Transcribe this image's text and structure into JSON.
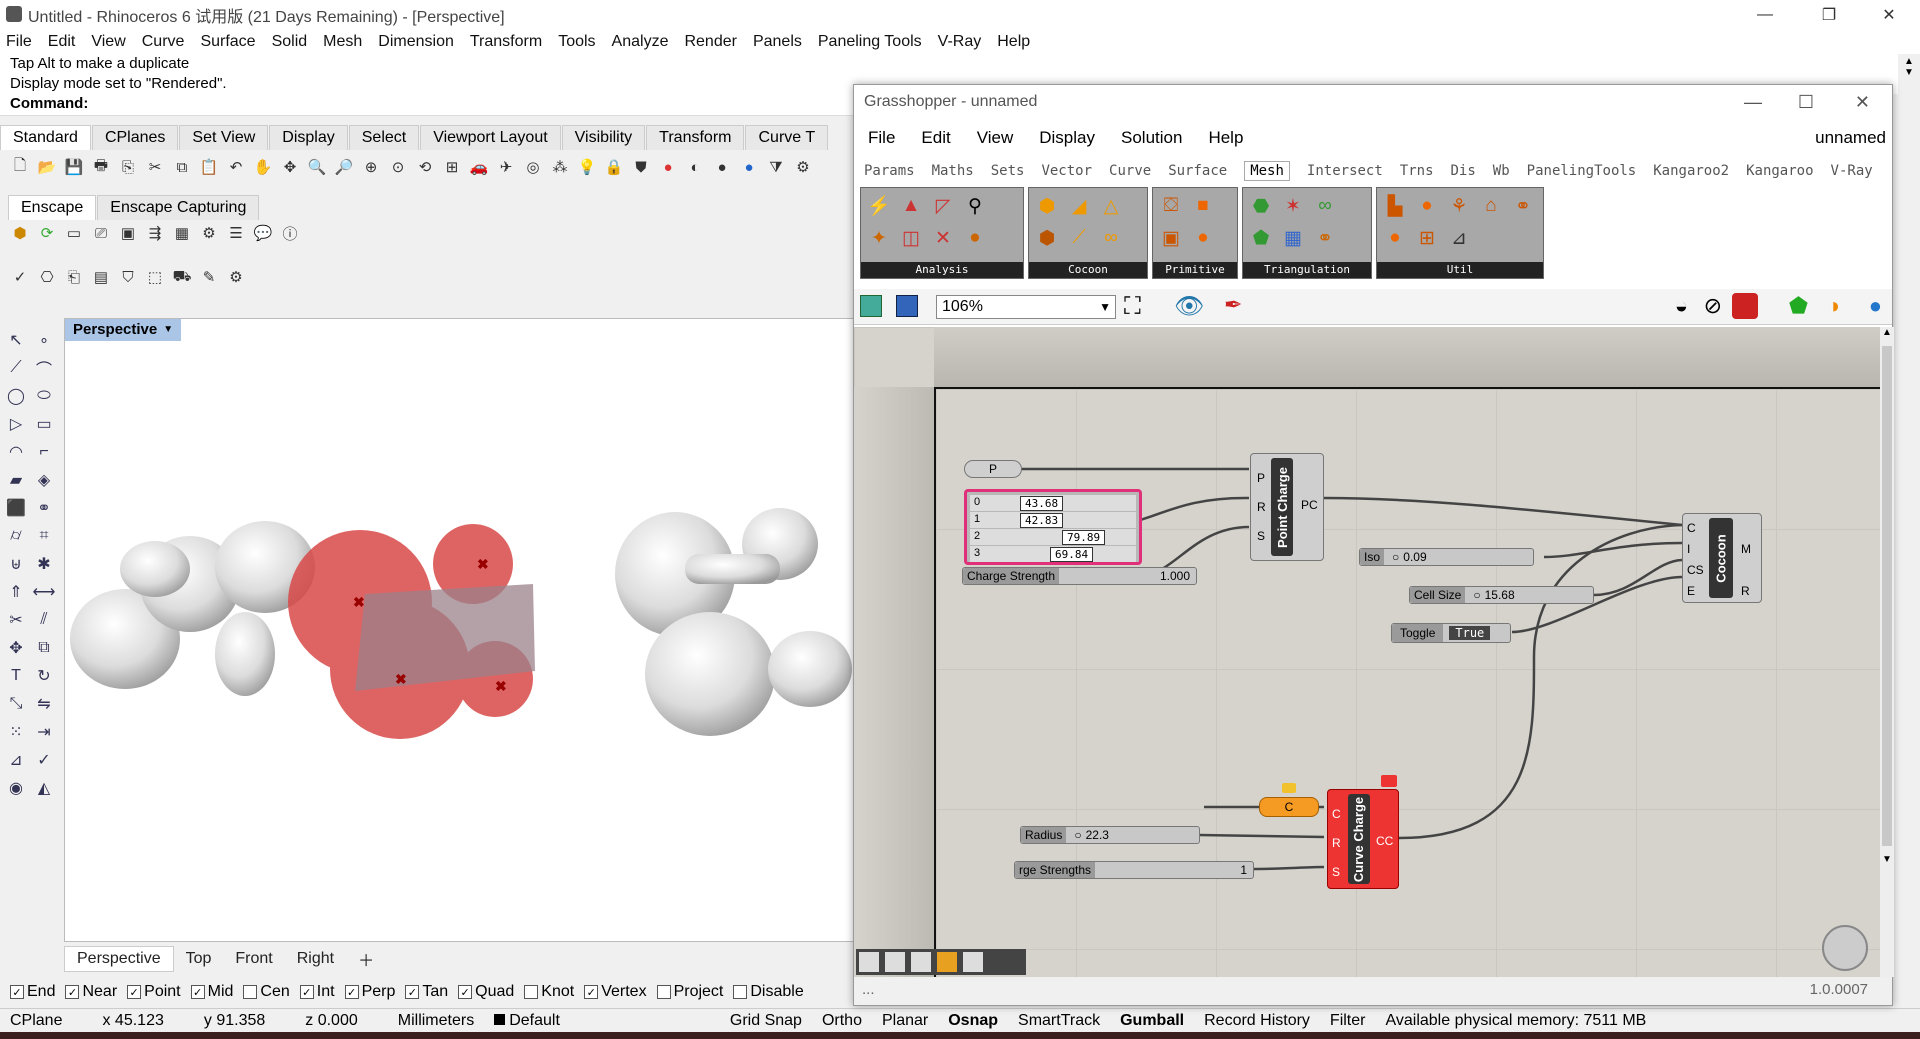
{
  "rhino": {
    "title": "Untitled - Rhinoceros 6 试用版 (21 Days Remaining) - [Perspective]",
    "window_buttons": [
      "—",
      "❐",
      "✕"
    ],
    "menu": [
      "File",
      "Edit",
      "View",
      "Curve",
      "Surface",
      "Solid",
      "Mesh",
      "Dimension",
      "Transform",
      "Tools",
      "Analyze",
      "Render",
      "Panels",
      "Paneling Tools",
      "V-Ray",
      "Help"
    ],
    "history": [
      "Tap Alt to make a duplicate",
      "Display mode set to \"Rendered\"."
    ],
    "command_label": "Command:",
    "toolbar_tabs": [
      "Standard",
      "CPlanes",
      "Set View",
      "Display",
      "Select",
      "Viewport Layout",
      "Visibility",
      "Transform",
      "Curve T"
    ],
    "enscape_tabs": [
      "Enscape",
      "Enscape Capturing"
    ],
    "viewport_label": "Perspective",
    "viewport_tabs": [
      "Perspective",
      "Top",
      "Front",
      "Right"
    ],
    "osnaps": [
      {
        "label": "End",
        "checked": true
      },
      {
        "label": "Near",
        "checked": true
      },
      {
        "label": "Point",
        "checked": true
      },
      {
        "label": "Mid",
        "checked": true
      },
      {
        "label": "Cen",
        "checked": false
      },
      {
        "label": "Int",
        "checked": true
      },
      {
        "label": "Perp",
        "checked": true
      },
      {
        "label": "Tan",
        "checked": true
      },
      {
        "label": "Quad",
        "checked": true
      },
      {
        "label": "Knot",
        "checked": false
      },
      {
        "label": "Vertex",
        "checked": true
      },
      {
        "label": "Project",
        "checked": false
      },
      {
        "label": "Disable",
        "checked": false
      }
    ],
    "status": {
      "cplane": "CPlane",
      "x": "x 45.123",
      "y": "y 91.358",
      "z": "z 0.000",
      "units": "Millimeters",
      "layer": "Default",
      "toggles": [
        {
          "label": "Grid Snap",
          "bold": false
        },
        {
          "label": "Ortho",
          "bold": false
        },
        {
          "label": "Planar",
          "bold": false
        },
        {
          "label": "Osnap",
          "bold": true
        },
        {
          "label": "SmartTrack",
          "bold": false
        },
        {
          "label": "Gumball",
          "bold": true
        },
        {
          "label": "Record History",
          "bold": false
        },
        {
          "label": "Filter",
          "bold": false
        }
      ],
      "memory": "Available physical memory: 7511 MB"
    }
  },
  "gh": {
    "title": "Grasshopper - unnamed",
    "menu": [
      "File",
      "Edit",
      "View",
      "Display",
      "Solution",
      "Help"
    ],
    "doc_name": "unnamed",
    "tabs": [
      "Params",
      "Maths",
      "Sets",
      "Vector",
      "Curve",
      "Surface",
      "Mesh",
      "Intersect",
      "Trns",
      "Dis",
      "Wb",
      "PanelingTools",
      "Kangaroo2",
      "Kangaroo",
      "V-Ray"
    ],
    "active_tab": "Mesh",
    "ribbon_groups": [
      "Analysis",
      "Cocoon",
      "Primitive",
      "Triangulation",
      "Util"
    ],
    "zoom": "106%",
    "version": "1.0.0007",
    "footer_dots": "...",
    "nodes": {
      "param_p": "P",
      "panel_values": [
        {
          "i": "0",
          "v": "43.68"
        },
        {
          "i": "1",
          "v": "42.83"
        },
        {
          "i": "2",
          "v": "79.89"
        },
        {
          "i": "3",
          "v": "69.84"
        }
      ],
      "charge_strength": {
        "label": "Charge Strength",
        "value": "1.000"
      },
      "point_charge": {
        "name": "Point Charge",
        "inputs": [
          "P",
          "R",
          "S"
        ],
        "output": "PC"
      },
      "iso": {
        "label": "Iso",
        "value": "0.09"
      },
      "cell_size": {
        "label": "Cell Size",
        "value": "15.68"
      },
      "toggle": {
        "label": "Toggle",
        "value": "True"
      },
      "cocoon": {
        "name": "Cocoon",
        "inputs": [
          "C",
          "I",
          "CS",
          "E"
        ],
        "outputs": [
          "M",
          "R"
        ]
      },
      "curve_param": "C",
      "radius": {
        "label": "Radius",
        "value": "22.3"
      },
      "charge_strengths": {
        "label": "rge Strengths",
        "value": "1"
      },
      "curve_charge": {
        "name": "Curve Charge",
        "inputs": [
          "C",
          "R",
          "S"
        ],
        "output": "CC"
      }
    }
  }
}
